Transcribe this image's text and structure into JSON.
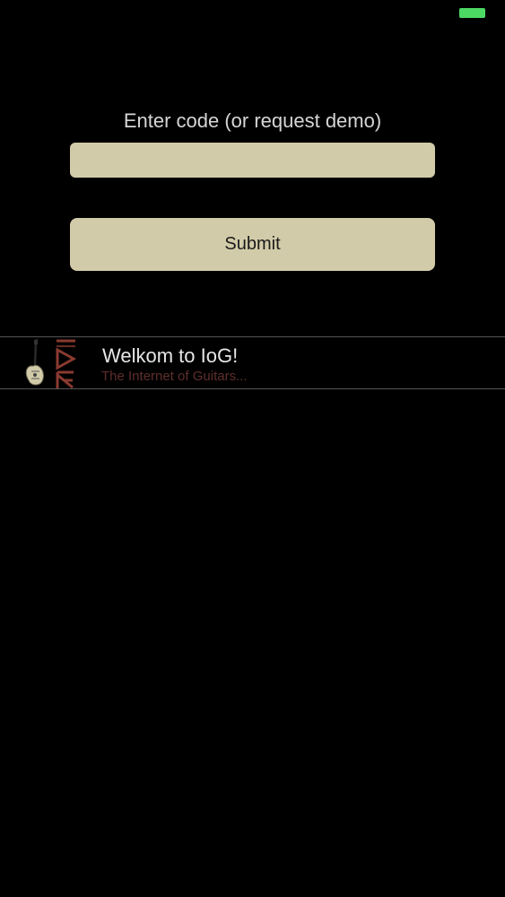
{
  "colors": {
    "background": "#000000",
    "field_fill": "#d2cba9",
    "battery": "#4cd964",
    "accent_dark_red": "#5e2e2c",
    "logo_red": "#8a3a30"
  },
  "status_bar": {
    "battery_icon": "battery-full-icon"
  },
  "login": {
    "prompt": "Enter code (or request demo)",
    "input_value": "",
    "submit_label": "Submit"
  },
  "messages": [
    {
      "title": "Welkom to IoG!",
      "subtitle": "The Internet of Guitars...",
      "icon": "iog-guitar-logo-icon"
    }
  ]
}
